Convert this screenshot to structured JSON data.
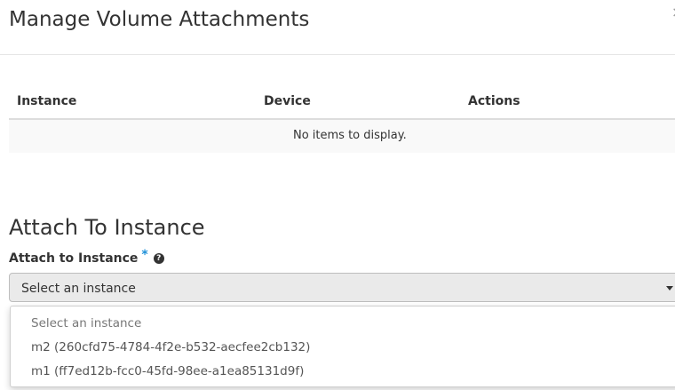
{
  "modal": {
    "title": "Manage Volume Attachments",
    "close_symbol": "×"
  },
  "table": {
    "headers": [
      "Instance",
      "Device",
      "Actions"
    ],
    "empty_message": "No items to display."
  },
  "attach": {
    "section_title": "Attach To Instance",
    "field_label": "Attach to Instance",
    "required_marker": "*",
    "help_symbol": "?",
    "select_value": "Select an instance",
    "options": [
      "Select an instance",
      "m2 (260cfd75-4784-4f2e-b532-aecfee2cb132)",
      "m1 (ff7ed12b-fcc0-45fd-98ee-a1ea85131d9f)"
    ]
  },
  "icons": [
    "close-icon",
    "help-icon",
    "caret-down-icon"
  ],
  "colors": {
    "required": "#1e90d8",
    "select_bg": "#eaeaea",
    "table_empty_bg": "#f9f9f9"
  }
}
